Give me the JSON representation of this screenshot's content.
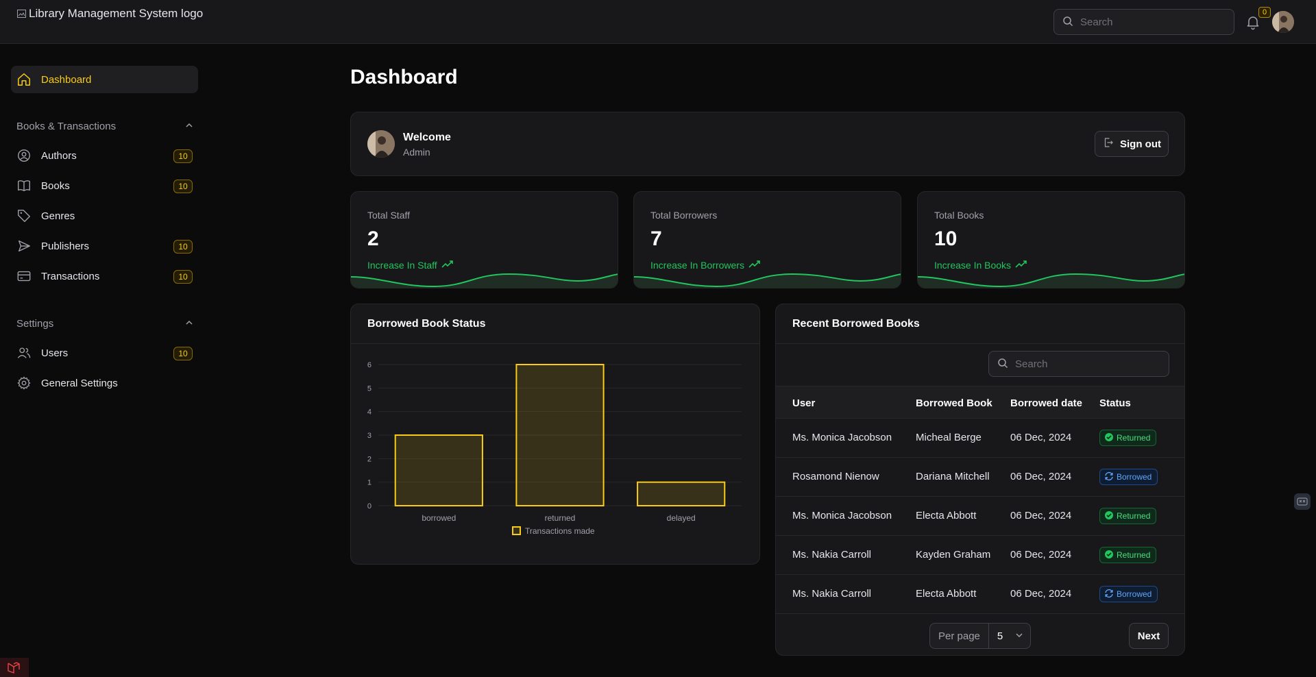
{
  "header": {
    "logo_alt": "Library Management System logo",
    "search_placeholder": "Search",
    "notifications_count": "0"
  },
  "sidebar": {
    "dashboard": "Dashboard",
    "group_books": "Books & Transactions",
    "items": [
      {
        "label": "Authors",
        "count": "10",
        "icon": "user-circle-icon"
      },
      {
        "label": "Books",
        "count": "10",
        "icon": "book-open-icon"
      },
      {
        "label": "Genres",
        "count": "",
        "icon": "tag-icon"
      },
      {
        "label": "Publishers",
        "count": "10",
        "icon": "paper-plane-icon"
      },
      {
        "label": "Transactions",
        "count": "10",
        "icon": "credit-card-icon"
      }
    ],
    "group_settings": "Settings",
    "settings_items": [
      {
        "label": "Users",
        "count": "10",
        "icon": "users-icon"
      },
      {
        "label": "General Settings",
        "count": "",
        "icon": "gear-icon"
      }
    ]
  },
  "main": {
    "title": "Dashboard",
    "welcome": {
      "title": "Welcome",
      "subtitle": "Admin",
      "signout": "Sign out"
    },
    "stats": [
      {
        "label": "Total Staff",
        "value": "2",
        "trend": "Increase In Staff"
      },
      {
        "label": "Total Borrowers",
        "value": "7",
        "trend": "Increase In Borrowers"
      },
      {
        "label": "Total Books",
        "value": "10",
        "trend": "Increase In Books"
      }
    ],
    "chart_title": "Borrowed Book Status",
    "recent": {
      "title": "Recent Borrowed Books",
      "search_placeholder": "Search",
      "columns": [
        "User",
        "Borrowed Book",
        "Borrowed date",
        "Status"
      ],
      "rows": [
        {
          "user": "Ms. Monica Jacobson",
          "book": "Micheal Berge",
          "date": "06 Dec, 2024",
          "status": "Returned"
        },
        {
          "user": "Rosamond Nienow",
          "book": "Dariana Mitchell",
          "date": "06 Dec, 2024",
          "status": "Borrowed"
        },
        {
          "user": "Ms. Monica Jacobson",
          "book": "Electa Abbott",
          "date": "06 Dec, 2024",
          "status": "Returned"
        },
        {
          "user": "Ms. Nakia Carroll",
          "book": "Kayden Graham",
          "date": "06 Dec, 2024",
          "status": "Returned"
        },
        {
          "user": "Ms. Nakia Carroll",
          "book": "Electa Abbott",
          "date": "06 Dec, 2024",
          "status": "Borrowed"
        }
      ],
      "per_page_label": "Per page",
      "per_page_value": "5",
      "next": "Next"
    }
  },
  "colors": {
    "accent": "#facc15",
    "positive": "#22c55e",
    "info": "#60a5fa"
  },
  "chart_data": {
    "type": "bar",
    "categories": [
      "borrowed",
      "returned",
      "delayed"
    ],
    "series": [
      {
        "name": "Transactions made",
        "values": [
          3,
          6,
          1
        ]
      }
    ],
    "title": "Borrowed Book Status",
    "xlabel": "",
    "ylabel": "",
    "ylim": [
      0,
      6
    ],
    "yticks": [
      0,
      1,
      2,
      3,
      4,
      5,
      6
    ],
    "legend": "bottom",
    "grid": true
  }
}
